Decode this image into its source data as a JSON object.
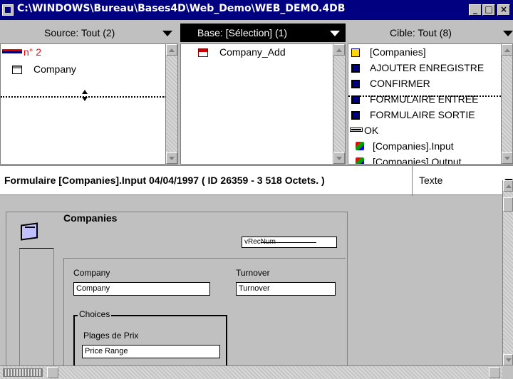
{
  "window": {
    "title": "C:\\WINDOWS\\Bureau\\Bases4D\\Web_Demo\\WEB_DEMO.4DB",
    "buttons": [
      "_",
      "□",
      "×"
    ]
  },
  "columns": {
    "source": {
      "label": "Source: Tout (2)",
      "items": [
        {
          "label": "n° 2",
          "color": "#ff0000",
          "icon": "record-icon"
        },
        {
          "label": "Company",
          "icon": "table-icon"
        }
      ]
    },
    "base": {
      "label": "Base: [Sélection] (1)",
      "items": [
        {
          "label": "Company_Add",
          "icon": "form-icon"
        }
      ]
    },
    "target": {
      "label": "Cible: Tout (8)",
      "items": [
        {
          "label": "[Companies]",
          "icon": "table-icon"
        },
        {
          "label": "AJOUTER ENREGISTRE",
          "icon": "method-icon"
        },
        {
          "label": "CONFIRMER",
          "icon": "method-icon"
        },
        {
          "label": "FORMULAIRE ENTREE",
          "icon": "method-icon"
        },
        {
          "label": "FORMULAIRE SORTIE",
          "icon": "method-icon"
        },
        {
          "label": "OK",
          "icon": "field-icon"
        },
        {
          "label": "[Companies].Input",
          "icon": "form-icon"
        },
        {
          "label": "[Companies].Output",
          "icon": "form-icon"
        }
      ]
    }
  },
  "info": {
    "text": "Formulaire [Companies].Input  04/04/1997 ( ID 26359 - 3 518 Octets. )",
    "type": "Texte"
  },
  "form": {
    "title": "Companies",
    "recnum": "vRecNum",
    "company_label": "Company",
    "company_value": "Company",
    "turnover_label": "Turnover",
    "turnover_value": "Turnover",
    "choices_label": "Choices",
    "price_label": "Plages de Prix",
    "price_value": "Price Range"
  }
}
